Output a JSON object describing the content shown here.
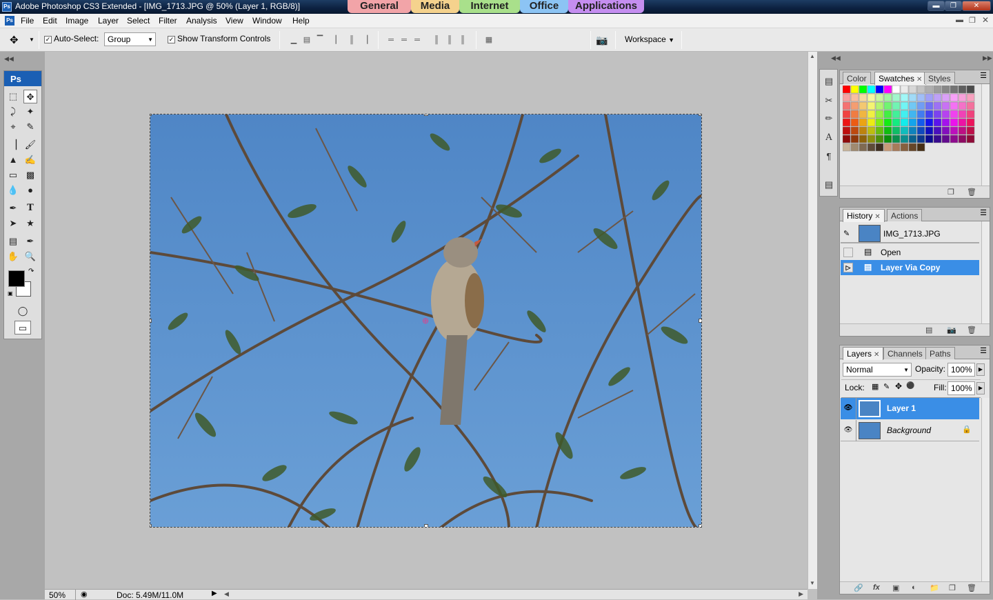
{
  "window": {
    "app_icon": "Ps",
    "title": "Adobe Photoshop CS3 Extended - [IMG_1713.JPG @ 50% (Layer 1, RGB/8)]",
    "category_tabs": [
      {
        "label": "General",
        "color": "#f2a4a8"
      },
      {
        "label": "Media",
        "color": "#f5d28d"
      },
      {
        "label": "Internet",
        "color": "#a9e08b"
      },
      {
        "label": "Office",
        "color": "#8cc4f4"
      },
      {
        "label": "Applications",
        "color": "#c58ef0"
      }
    ],
    "controls": [
      "minimize",
      "restore",
      "close"
    ]
  },
  "menubar": {
    "items": [
      "File",
      "Edit",
      "Image",
      "Layer",
      "Select",
      "Filter",
      "Analysis",
      "View",
      "Window",
      "Help"
    ]
  },
  "options_bar": {
    "auto_select_label": "Auto-Select:",
    "auto_select_checked": true,
    "auto_select_value": "Group",
    "transform_label": "Show Transform Controls",
    "transform_checked": true,
    "workspace_label": "Workspace"
  },
  "toolbox": {
    "header": "Ps",
    "tools": [
      "marquee-tool",
      "move-tool",
      "lasso-tool",
      "magic-wand-tool",
      "crop-tool",
      "slice-tool",
      "healing-brush-tool",
      "brush-tool",
      "clone-stamp-tool",
      "history-brush-tool",
      "eraser-tool",
      "gradient-tool",
      "blur-tool",
      "dodge-tool",
      "pen-tool",
      "type-tool",
      "path-selection-tool",
      "shape-tool",
      "notes-tool",
      "eyedropper-tool",
      "hand-tool",
      "zoom-tool"
    ],
    "type_glyph": "T",
    "foreground_color": "#000000",
    "background_color": "#ffffff"
  },
  "document": {
    "file": "IMG_1713.JPG",
    "sky_color": "#5b93cf"
  },
  "status_bar": {
    "zoom": "50%",
    "doc_info": "Doc: 5.49M/11.0M"
  },
  "swatches_panel": {
    "tabs": [
      "Color",
      "Swatches",
      "Styles"
    ],
    "active_tab": "Swatches",
    "top_row": [
      "#ff0000",
      "#ffff00",
      "#00ff00",
      "#00ffff",
      "#0000ff",
      "#ff00ff",
      "#ffffff",
      "#ebebeb",
      "#d7d7d7",
      "#c3c3c3",
      "#afafaf",
      "#9b9b9b",
      "#878787",
      "#737373",
      "#5f5f5f",
      "#4b4b4b"
    ],
    "bottom_row": [
      "#c8b49a",
      "#a08a70",
      "#7f6a52",
      "#5e4b38",
      "#3d2e20",
      "#c89a78",
      "#a77b5a",
      "#86603f",
      "#664628",
      "#462e14"
    ]
  },
  "history_panel": {
    "tabs": [
      "History",
      "Actions"
    ],
    "active_tab": "History",
    "snapshot": "IMG_1713.JPG",
    "steps": [
      {
        "label": "Open",
        "active": false
      },
      {
        "label": "Layer Via Copy",
        "active": true
      }
    ]
  },
  "layers_panel": {
    "tabs": [
      "Layers",
      "Channels",
      "Paths"
    ],
    "active_tab": "Layers",
    "blend_mode": "Normal",
    "opacity_label": "Opacity:",
    "opacity": "100%",
    "lock_label": "Lock:",
    "fill_label": "Fill:",
    "fill": "100%",
    "layers": [
      {
        "name": "Layer 1",
        "active": true,
        "locked": false
      },
      {
        "name": "Background",
        "active": false,
        "locked": true
      }
    ]
  }
}
